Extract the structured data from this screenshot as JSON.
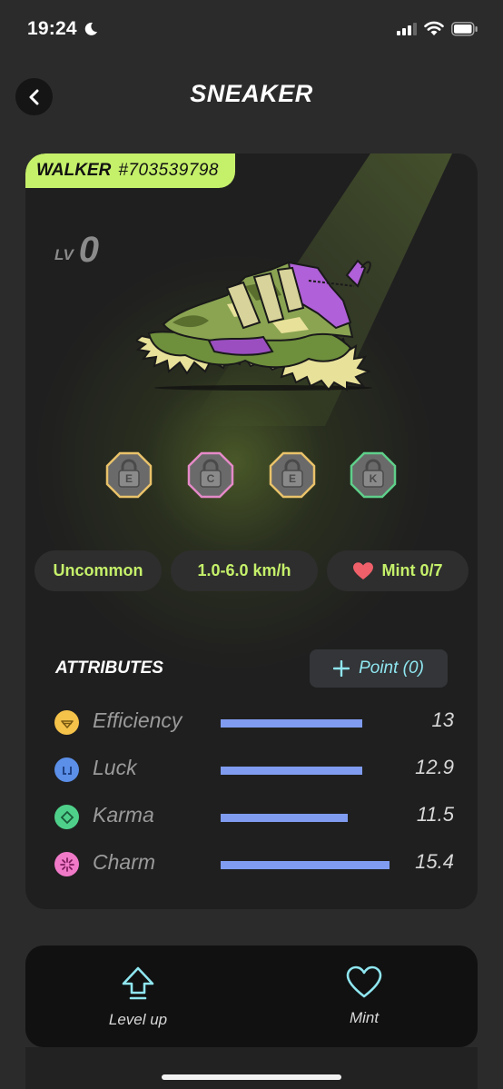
{
  "status_bar": {
    "time": "19:24"
  },
  "header": {
    "title": "SNEAKER"
  },
  "sneaker": {
    "type": "WALKER",
    "id": "#703539798",
    "level_label": "LV",
    "level_value": "0",
    "sockets": [
      {
        "letter": "E",
        "color": "#e9c26a"
      },
      {
        "letter": "C",
        "color": "#e58ac8"
      },
      {
        "letter": "E",
        "color": "#e9c26a"
      },
      {
        "letter": "K",
        "color": "#5fcf8a"
      }
    ],
    "rarity": "Uncommon",
    "speed": "1.0-6.0 km/h",
    "mint": "Mint 0/7"
  },
  "attributes": {
    "heading": "ATTRIBUTES",
    "point_button": "Point (0)",
    "items": [
      {
        "label": "Efficiency",
        "value": "13",
        "fill": 0.84,
        "icon": "efficiency-icon",
        "color": "#f5c24a"
      },
      {
        "label": "Luck",
        "value": "12.9",
        "fill": 0.84,
        "icon": "luck-icon",
        "color": "#5b8fe8"
      },
      {
        "label": "Karma",
        "value": "11.5",
        "fill": 0.75,
        "icon": "karma-icon",
        "color": "#4fd08a"
      },
      {
        "label": "Charm",
        "value": "15.4",
        "fill": 1.0,
        "icon": "charm-icon",
        "color": "#f07ac8"
      }
    ]
  },
  "actions": {
    "level_up": "Level up",
    "mint": "Mint"
  },
  "colors": {
    "accent": "#c5f06a",
    "bar": "#7f9cf0",
    "cyan": "#8fe6f0"
  }
}
